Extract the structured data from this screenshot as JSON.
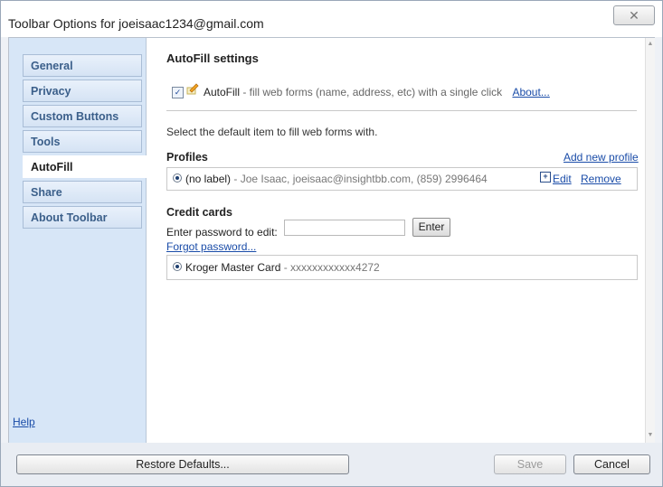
{
  "window": {
    "title": "Toolbar Options for joeisaac1234@gmail.com",
    "close_glyph": "✕"
  },
  "sidebar": {
    "items": [
      {
        "label": "General"
      },
      {
        "label": "Privacy"
      },
      {
        "label": "Custom Buttons"
      },
      {
        "label": "Tools"
      },
      {
        "label": "AutoFill",
        "active": true
      },
      {
        "label": "Share"
      },
      {
        "label": "About Toolbar"
      }
    ],
    "help_label": "Help"
  },
  "autofill": {
    "heading": "AutoFill settings",
    "enable_label": "AutoFill",
    "enable_desc": " - fill web forms (name, address, etc) with a single click",
    "about_link": "About...",
    "select_text": "Select the default item to fill web forms with.",
    "profiles_heading": "Profiles",
    "add_profile_link": "Add new profile",
    "profile": {
      "label": "(no label)",
      "details": " - Joe Isaac, joeisaac@insightbb.com, (859) 2996464",
      "edit_link": "Edit",
      "remove_link": "Remove"
    },
    "credit_cards_heading": "Credit cards",
    "password_label": "Enter password to edit:",
    "enter_button": "Enter",
    "forgot_link": "Forgot password...",
    "card": {
      "label": "Kroger Master Card",
      "number": " - xxxxxxxxxxxx4272"
    }
  },
  "footer": {
    "restore_label": "Restore Defaults...",
    "save_label": "Save",
    "cancel_label": "Cancel"
  },
  "colors": {
    "link": "#1a4ca8",
    "sidebar_bg": "#d7e6f7",
    "nav_text": "#3b5f8a"
  }
}
